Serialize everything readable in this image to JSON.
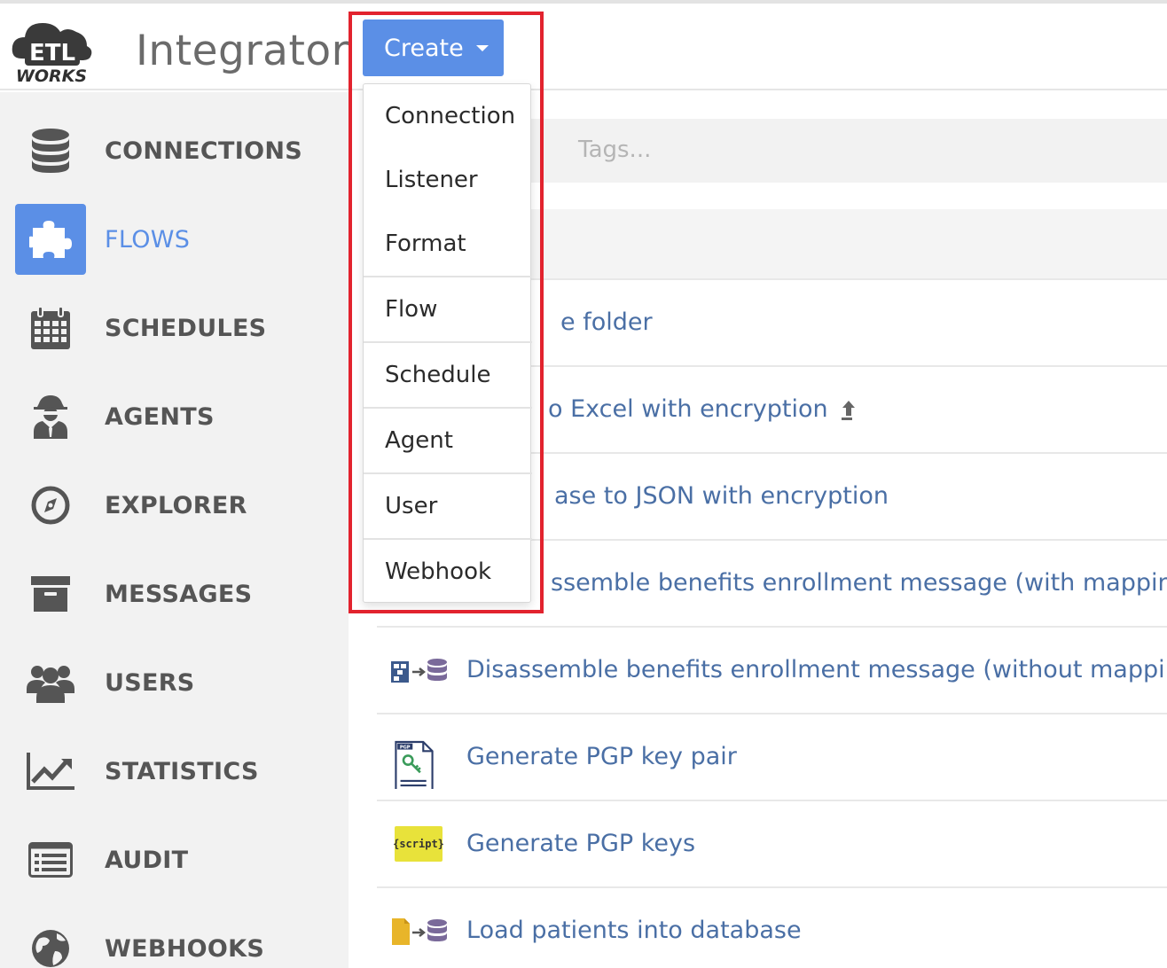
{
  "header": {
    "logo_top": "ETL",
    "logo_bottom": "WORKS",
    "app_title": "Integrator",
    "create_label": "Create"
  },
  "sidebar": {
    "items": [
      {
        "label": "CONNECTIONS",
        "icon": "database-icon"
      },
      {
        "label": "FLOWS",
        "icon": "puzzle-icon",
        "active": true
      },
      {
        "label": "SCHEDULES",
        "icon": "calendar-icon"
      },
      {
        "label": "AGENTS",
        "icon": "agent-icon"
      },
      {
        "label": "EXPLORER",
        "icon": "compass-icon"
      },
      {
        "label": "MESSAGES",
        "icon": "archive-icon"
      },
      {
        "label": "USERS",
        "icon": "users-icon"
      },
      {
        "label": "STATISTICS",
        "icon": "chart-icon"
      },
      {
        "label": "AUDIT",
        "icon": "list-icon"
      },
      {
        "label": "WEBHOOKS",
        "icon": "globe-icon"
      }
    ]
  },
  "main": {
    "search_placeholder": "Tags...",
    "flows": [
      {
        "name": "e folder"
      },
      {
        "name": "o Excel with encryption",
        "uploaded": true
      },
      {
        "name": "ase to JSON with encryption"
      },
      {
        "name": "ssemble benefits enrollment message (with mapping)"
      },
      {
        "name": "Disassemble benefits enrollment message (without mapping)",
        "icon": "format-to-database-icon"
      },
      {
        "name": "Generate PGP key pair",
        "icon": "pgp-key-icon"
      },
      {
        "name": "Generate PGP keys",
        "icon": "script-icon",
        "icon_text": "{script}"
      },
      {
        "name": "Load patients into database",
        "icon": "file-to-database-icon"
      }
    ]
  },
  "dropdown": {
    "items": [
      "Connection",
      "Listener",
      "Format",
      "Flow",
      "Schedule",
      "Agent",
      "User",
      "Webhook"
    ]
  },
  "colors": {
    "accent": "#5b8fe6",
    "link": "#4a6fa5",
    "highlight": "#e2232e"
  }
}
